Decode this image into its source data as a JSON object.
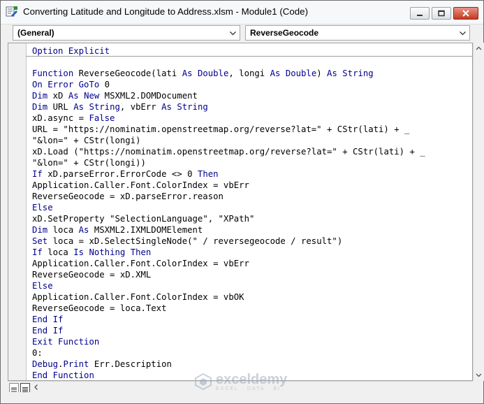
{
  "window": {
    "title": "Converting Latitude and Longitude to Address.xlsm - Module1 (Code)"
  },
  "combos": {
    "object": "(General)",
    "procedure": "ReverseGeocode"
  },
  "watermark": {
    "brand": "exceldemy",
    "tagline": "EXCEL · DATA · BI"
  },
  "code_lines": [
    "Option Explicit",
    "",
    "Function ReverseGeocode(lati As Double, longi As Double) As String",
    "On Error GoTo 0",
    "Dim xD As New MSXML2.DOMDocument",
    "Dim URL As String, vbErr As String",
    "xD.async = False",
    "URL = \"https://nominatim.openstreetmap.org/reverse?lat=\" + CStr(lati) + _",
    "\"&lon=\" + CStr(longi)",
    "xD.Load (\"https://nominatim.openstreetmap.org/reverse?lat=\" + CStr(lati) + _",
    "\"&lon=\" + CStr(longi))",
    "If xD.parseError.ErrorCode <> 0 Then",
    "Application.Caller.Font.ColorIndex = vbErr",
    "ReverseGeocode = xD.parseError.reason",
    "Else",
    "xD.SetProperty \"SelectionLanguage\", \"XPath\"",
    "Dim loca As MSXML2.IXMLDOMElement",
    "Set loca = xD.SelectSingleNode(\" / reversegeocode / result\")",
    "If loca Is Nothing Then",
    "Application.Caller.Font.ColorIndex = vbErr",
    "ReverseGeocode = xD.XML",
    "Else",
    "Application.Caller.Font.ColorIndex = vbOK",
    "ReverseGeocode = loca.Text",
    "End If",
    "End If",
    "Exit Function",
    "0:",
    "Debug.Print Err.Description",
    "End Function"
  ],
  "colors": {
    "keyword": "#00008b",
    "text": "#000000",
    "close_button": "#c33a21"
  }
}
